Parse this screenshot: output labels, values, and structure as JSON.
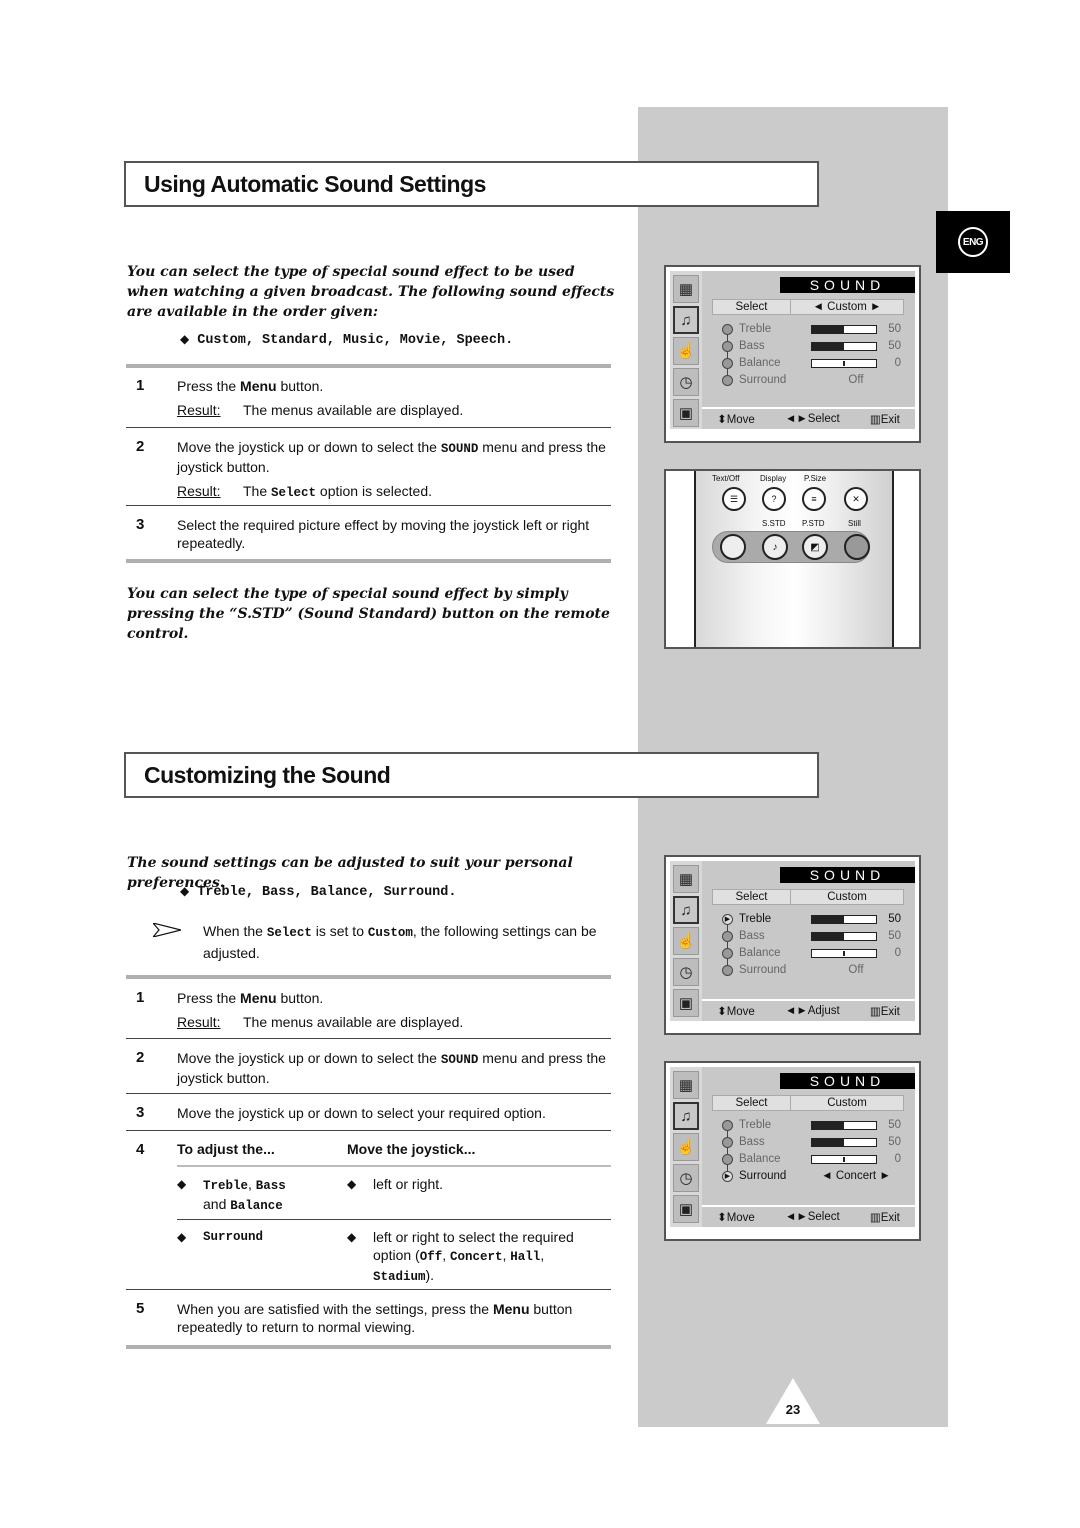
{
  "language_tab": "ENG",
  "page_number": "23",
  "section1": {
    "title": "Using Automatic Sound Settings",
    "intro": "You can select the type of special sound effect to be used when watching a given broadcast. The following sound effects are available in the order given:",
    "effects": "Custom, Standard, Music, Movie, Speech.",
    "steps": [
      {
        "num": "1",
        "text_pre": "Press the ",
        "text_bold": "Menu",
        "text_post": " button.",
        "result_label": "Result:",
        "result": "The menus available are displayed."
      },
      {
        "num": "2",
        "text_pre": "Move the joystick up or down to select the ",
        "text_mono": "SOUND",
        "text_post": " menu and press the joystick button.",
        "result_label": "Result:",
        "result_pre": "The ",
        "result_mono": "Select",
        "result_post": " option is selected."
      },
      {
        "num": "3",
        "text": "Select the required picture effect by moving the joystick left or right repeatedly."
      }
    ],
    "outro": "You can select the type of special sound effect by simply pressing the “S.STD” (Sound Standard) button on the remote control."
  },
  "section2": {
    "title": "Customizing the Sound",
    "intro": "The sound settings can be adjusted to suit your personal preferences.",
    "options": "Treble, Bass, Balance, Surround.",
    "note_pre": "When the ",
    "note_mono1": "Select",
    "note_mid": " is set to ",
    "note_mono2": "Custom",
    "note_post": ", the following settings can be adjusted.",
    "steps": [
      {
        "num": "1",
        "text_pre": "Press the ",
        "text_bold": "Menu",
        "text_post": " button.",
        "result_label": "Result:",
        "result": "The menus available are displayed."
      },
      {
        "num": "2",
        "text_pre": "Move the joystick up or down to select the ",
        "text_mono": "SOUND",
        "text_post": " menu and press the joystick button."
      },
      {
        "num": "3",
        "text": "Move the joystick up or down to select your required option."
      },
      {
        "num": "4",
        "col1": "To adjust the...",
        "col2": "Move the joystick..."
      },
      {
        "num": "5",
        "text_pre": "When you are satisfied with the settings, press the ",
        "text_bold": "Menu",
        "text_post": " button repeatedly to return to normal viewing."
      }
    ],
    "adjust_table": [
      {
        "item_mono1": "Treble",
        "item_sep": ", ",
        "item_mono2": "Bass",
        "item_and": "and ",
        "item_mono3": "Balance",
        "action": "left or right."
      },
      {
        "item_mono1": "Surround",
        "action_pre": "left or right to select the required option (",
        "opt1": "Off",
        "opt2": "Concert",
        "opt3": "Hall",
        "opt4": "Stadium",
        "action_post": ")."
      }
    ]
  },
  "osd_screens": [
    {
      "title": "SOUND",
      "select_label": "Select",
      "select_value": "◄  Custom  ►",
      "rows": [
        {
          "label": "Treble",
          "value": "50",
          "level": 0.5,
          "type": "bar"
        },
        {
          "label": "Bass",
          "value": "50",
          "level": 0.5,
          "type": "bar"
        },
        {
          "label": "Balance",
          "value": "0",
          "level": 0.5,
          "type": "balance"
        },
        {
          "label": "Surround",
          "value": "Off",
          "type": "text"
        }
      ],
      "footer": [
        "⬍Move",
        "◄►Select",
        "▥Exit"
      ]
    },
    {
      "title": "SOUND",
      "select_label": "Select",
      "select_value": "Custom",
      "rows": [
        {
          "label": "Treble",
          "value": "50",
          "level": 0.5,
          "type": "bar"
        },
        {
          "label": "Bass",
          "value": "50",
          "level": 0.5,
          "type": "bar"
        },
        {
          "label": "Balance",
          "value": "0",
          "level": 0.5,
          "type": "balance"
        },
        {
          "label": "Surround",
          "value": "Off",
          "type": "text"
        }
      ],
      "footer": [
        "⬍Move",
        "◄►Adjust",
        "▥Exit"
      ]
    },
    {
      "title": "SOUND",
      "select_label": "Select",
      "select_value": "Custom",
      "rows": [
        {
          "label": "Treble",
          "value": "50",
          "level": 0.5,
          "type": "bar"
        },
        {
          "label": "Bass",
          "value": "50",
          "level": 0.5,
          "type": "bar"
        },
        {
          "label": "Balance",
          "value": "0",
          "level": 0.5,
          "type": "balance"
        },
        {
          "label": "Surround",
          "value": "◄  Concert  ►",
          "type": "text"
        }
      ],
      "footer": [
        "⬍Move",
        "◄►Select",
        "▥Exit"
      ]
    }
  ],
  "remote": {
    "top_labels": [
      "Text/Off",
      "Display",
      "P.Size"
    ],
    "mid_labels": [
      "S.STD",
      "P.STD",
      "Still"
    ]
  }
}
